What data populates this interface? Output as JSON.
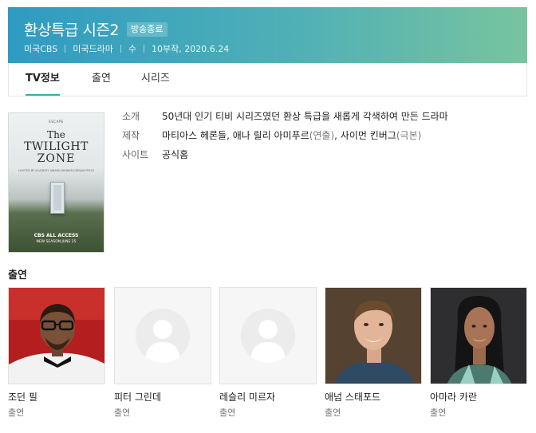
{
  "header": {
    "title": "환상특급 시즌2",
    "status_badge": "방송종료",
    "meta": [
      "미국CBS",
      "미국드라마",
      "수",
      "10부작, 2020.6.24"
    ]
  },
  "tabs": [
    {
      "label": "TV정보",
      "active": true
    },
    {
      "label": "출연",
      "active": false
    },
    {
      "label": "시리즈",
      "active": false
    }
  ],
  "poster": {
    "escape": "ESCAPE",
    "title_lines": [
      "The",
      "TWILIGHT",
      "ZONE"
    ],
    "host": "HOSTED BY ACADEMY AWARD WINNER JORDAN PEELE",
    "network": "CBS ALL ACCESS",
    "season": "NEW SEASON JUNE 25"
  },
  "info": {
    "summary_label": "소개",
    "summary": "50년대 인기 티비 시리즈였던 환상 특급을 새롭게 각색하여 만든 드라마",
    "production_label": "제작",
    "production_person1": "마티아스 헤론들, 애나 릴리 아미푸르",
    "production_role1": "(연출)",
    "production_sep": ", ",
    "production_person2": "사이먼 킨버그",
    "production_role2": "(극본)",
    "site_label": "사이트",
    "site_link": "공식홈"
  },
  "cast_title": "출연",
  "cast": [
    {
      "name": "조던 필",
      "role": "출연",
      "photo": "photo"
    },
    {
      "name": "피터 그린데",
      "role": "출연",
      "photo": "placeholder"
    },
    {
      "name": "레슬리 미르자",
      "role": "출연",
      "photo": "placeholder"
    },
    {
      "name": "애넘 스태포드",
      "role": "출연",
      "photo": "photo"
    },
    {
      "name": "아마라 카란",
      "role": "출연",
      "photo": "photo"
    }
  ],
  "colors": {
    "banner_start": "#2f9bc2",
    "banner_end": "#78c49e",
    "tab_accent": "#3ab0a8"
  }
}
